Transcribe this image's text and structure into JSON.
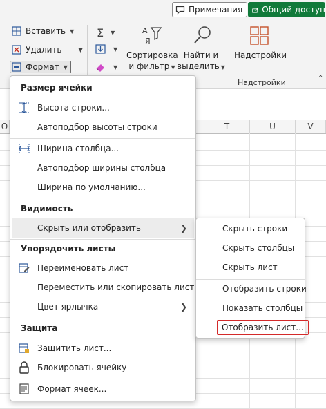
{
  "top_bar": {
    "comments_label": "Примечания",
    "share_label": "Общий доступ"
  },
  "ribbon": {
    "insert_label": "Вставить",
    "delete_label": "Удалить",
    "format_label": "Формат",
    "sort_filter_line1": "Сортировка",
    "sort_filter_line2": "и фильтр",
    "find_select_line1": "Найти и",
    "find_select_line2": "выделить",
    "addins_label": "Надстройки",
    "addins_group_label": "Надстройки"
  },
  "columns": [
    "O",
    "T",
    "U",
    "V"
  ],
  "format_menu": {
    "cell_size_header": "Размер ячейки",
    "row_height": "Высота строки...",
    "autofit_row": "Автоподбор высоты строки",
    "column_width": "Ширина столбца...",
    "autofit_column": "Автоподбор ширины столбца",
    "default_width": "Ширина по умолчанию...",
    "visibility_header": "Видимость",
    "hide_unhide": "Скрыть или отобразить",
    "organize_header": "Упорядочить листы",
    "rename_sheet": "Переименовать лист",
    "move_copy_sheet": "Переместить или скопировать лист...",
    "tab_color": "Цвет ярлычка",
    "protection_header": "Защита",
    "protect_sheet": "Защитить лист...",
    "lock_cell": "Блокировать ячейку",
    "format_cells": "Формат ячеек..."
  },
  "hide_submenu": {
    "hide_rows": "Скрыть строки",
    "hide_columns": "Скрыть столбцы",
    "hide_sheet": "Скрыть лист",
    "unhide_rows": "Отобразить строки",
    "unhide_columns": "Показать столбцы",
    "unhide_sheet": "Отобразить лист..."
  },
  "colors": {
    "share_green": "#117a3a",
    "highlight_red": "#d42a2a"
  }
}
